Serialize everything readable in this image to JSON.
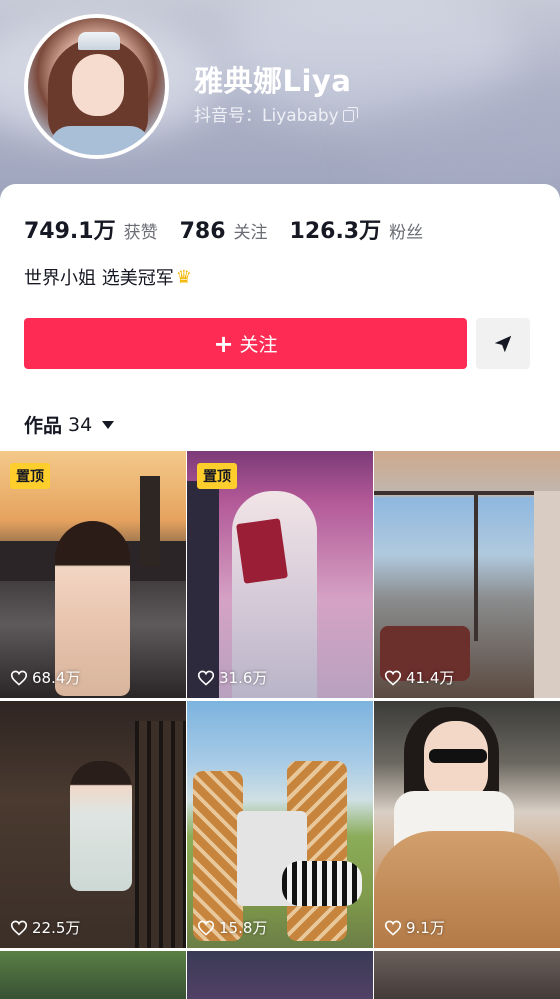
{
  "profile": {
    "name": "雅典娜Liya",
    "douyin_id": "抖音号：Liyababy"
  },
  "stats": [
    {
      "value": "749.1万",
      "label": "获赞"
    },
    {
      "value": "786",
      "label": "关注"
    },
    {
      "value": "126.3万",
      "label": "粉丝"
    }
  ],
  "bio": "世界小姐 选美冠军",
  "actions": {
    "follow_label": "关注",
    "follow_icon": "plus-icon",
    "share_icon": "paper-plane-icon"
  },
  "works_tab": {
    "label": "作品",
    "count": "34"
  },
  "pinned_label": "置顶",
  "videos": [
    {
      "likes": "68.4万",
      "pinned": true
    },
    {
      "likes": "31.6万",
      "pinned": true
    },
    {
      "likes": "41.4万",
      "pinned": false
    },
    {
      "likes": "22.5万",
      "pinned": false
    },
    {
      "likes": "15.8万",
      "pinned": false
    },
    {
      "likes": "9.1万",
      "pinned": false
    }
  ],
  "colors": {
    "accent": "#fe2c55",
    "pin_badge": "#fece2c",
    "text_primary": "#161823",
    "text_secondary": "#6b6d75"
  }
}
